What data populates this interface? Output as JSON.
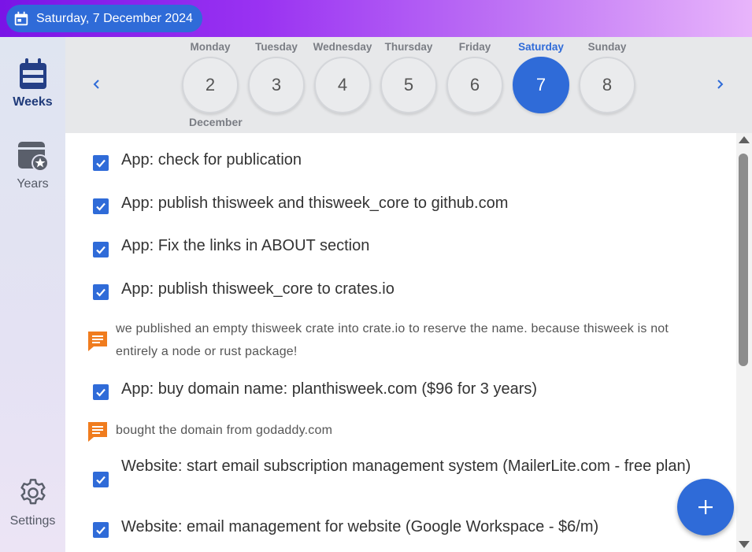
{
  "header": {
    "date": "Saturday, 7 December 2024",
    "icon": "calendar-icon"
  },
  "sidebar": {
    "weeks": {
      "label": "Weeks",
      "icon": "calendar-week-icon"
    },
    "years": {
      "label": "Years",
      "icon": "calendar-star-icon"
    },
    "settings": {
      "label": "Settings",
      "icon": "gear-icon"
    }
  },
  "week": {
    "month": "December",
    "days": [
      {
        "name": "Monday",
        "number": "2"
      },
      {
        "name": "Tuesday",
        "number": "3"
      },
      {
        "name": "Wednesday",
        "number": "4"
      },
      {
        "name": "Thursday",
        "number": "5"
      },
      {
        "name": "Friday",
        "number": "6"
      },
      {
        "name": "Saturday",
        "number": "7"
      },
      {
        "name": "Sunday",
        "number": "8"
      }
    ],
    "selected_index": 5
  },
  "items": [
    {
      "type": "task",
      "text": "App: check for publication",
      "checked": true
    },
    {
      "type": "task",
      "text": "App: publish thisweek and thisweek_core to github.com",
      "checked": true
    },
    {
      "type": "task",
      "text": "App: Fix the links in ABOUT section",
      "checked": true
    },
    {
      "type": "task",
      "text": "App: publish thisweek_core to crates.io",
      "checked": true
    },
    {
      "type": "note",
      "text": "we published an empty thisweek crate into crate.io to reserve the name. because thisweek is not entirely a node or rust package!"
    },
    {
      "type": "task",
      "text": "App: buy domain name: planthisweek.com ($96 for 3 years)",
      "checked": true
    },
    {
      "type": "note",
      "text": "bought the domain from godaddy.com"
    },
    {
      "type": "task",
      "text": "Website: start email subscription management system (MailerLite.com - free plan)",
      "checked": true
    },
    {
      "type": "task",
      "text": "Website: email management for website (Google Workspace - $6/m)",
      "checked": true
    }
  ],
  "fab": {
    "icon": "plus-icon"
  },
  "colors": {
    "accent": "#2f6bd8",
    "note": "#f07c1e"
  }
}
